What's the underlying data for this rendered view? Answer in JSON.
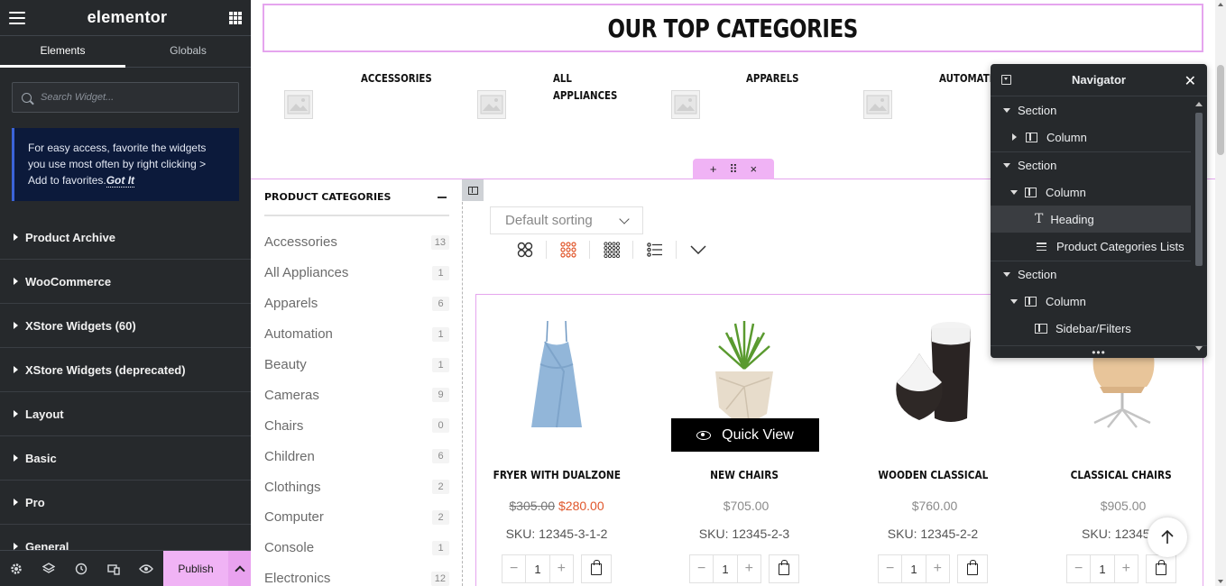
{
  "panel": {
    "logo": "elementor",
    "tabs": [
      "Elements",
      "Globals"
    ],
    "search_placeholder": "Search Widget...",
    "tip_text": "For easy access, favorite the widgets you use most often by right clicking > Add to favorites.",
    "tip_link": "Got It",
    "categories": [
      "Product Archive",
      "WooCommerce",
      "XStore Widgets (60)",
      "XStore Widgets (deprecated)",
      "Layout",
      "Basic",
      "Pro",
      "General"
    ],
    "footer": {
      "icons": [
        "settings-icon",
        "layers-icon",
        "history-icon",
        "responsive-icon",
        "preview-eye-icon"
      ],
      "publish_label": "Publish"
    }
  },
  "canvas": {
    "heading": "OUR TOP CATEGORIES",
    "top_categories": [
      "ACCESSORIES",
      "ALL APPLIANCES",
      "APPARELS",
      "AUTOMATION"
    ],
    "section_handle": [
      "+",
      "⠿",
      "×"
    ],
    "sidebar": {
      "title": "PRODUCT CATEGORIES",
      "items": [
        {
          "name": "Accessories",
          "count": "13"
        },
        {
          "name": "All Appliances",
          "count": "1"
        },
        {
          "name": "Apparels",
          "count": "6"
        },
        {
          "name": "Automation",
          "count": "1"
        },
        {
          "name": "Beauty",
          "count": "1"
        },
        {
          "name": "Cameras",
          "count": "9"
        },
        {
          "name": "Chairs",
          "count": "0"
        },
        {
          "name": "Children",
          "count": "6"
        },
        {
          "name": "Clothings",
          "count": "2"
        },
        {
          "name": "Computer",
          "count": "2"
        },
        {
          "name": "Console",
          "count": "1"
        },
        {
          "name": "Electronics",
          "count": "12"
        }
      ]
    },
    "sorting": "Default sorting",
    "view_modes": [
      "grid-2-icon",
      "grid-3-icon",
      "grid-4-icon",
      "list-icon",
      "more-chevron-icon"
    ],
    "active_view": "grid-3-icon",
    "accent_color": "#e0562b",
    "editor_highlight_color": "#e5a5ee",
    "quick_view": "Quick View",
    "products": [
      {
        "name": "FRYER WITH DUALZONE",
        "old_price": "$305.00",
        "price": "$280.00",
        "sku": "SKU: 12345-3-1-2",
        "qty": "1",
        "image": "blue-dress"
      },
      {
        "name": "NEW CHAIRS",
        "old_price": "",
        "price": "$705.00",
        "sku": "SKU: 12345-2-3",
        "qty": "1",
        "image": "potted-plant"
      },
      {
        "name": "WOODEN CLASSICAL",
        "old_price": "",
        "price": "$760.00",
        "sku": "SKU: 12345-2-2",
        "qty": "1",
        "image": "black-vases"
      },
      {
        "name": "CLASSICAL CHAIRS",
        "old_price": "",
        "price": "$905.00",
        "sku": "SKU: 12345-2",
        "qty": "1",
        "image": "swivel-chair"
      }
    ]
  },
  "navigator": {
    "title": "Navigator",
    "tree": [
      {
        "type": "section",
        "label": "Section",
        "level": 0,
        "expanded": true
      },
      {
        "type": "column",
        "label": "Column",
        "level": 1,
        "expanded": false
      },
      {
        "type": "section",
        "label": "Section",
        "level": 0,
        "expanded": true
      },
      {
        "type": "column",
        "label": "Column",
        "level": 1,
        "expanded": true
      },
      {
        "type": "heading",
        "label": "Heading",
        "level": 2,
        "selected": true
      },
      {
        "type": "list",
        "label": "Product Categories Lists",
        "level": 2
      },
      {
        "type": "section",
        "label": "Section",
        "level": 0,
        "expanded": true
      },
      {
        "type": "column",
        "label": "Column",
        "level": 1,
        "expanded": true
      },
      {
        "type": "sidebar",
        "label": "Sidebar/Filters",
        "level": 2
      }
    ]
  }
}
